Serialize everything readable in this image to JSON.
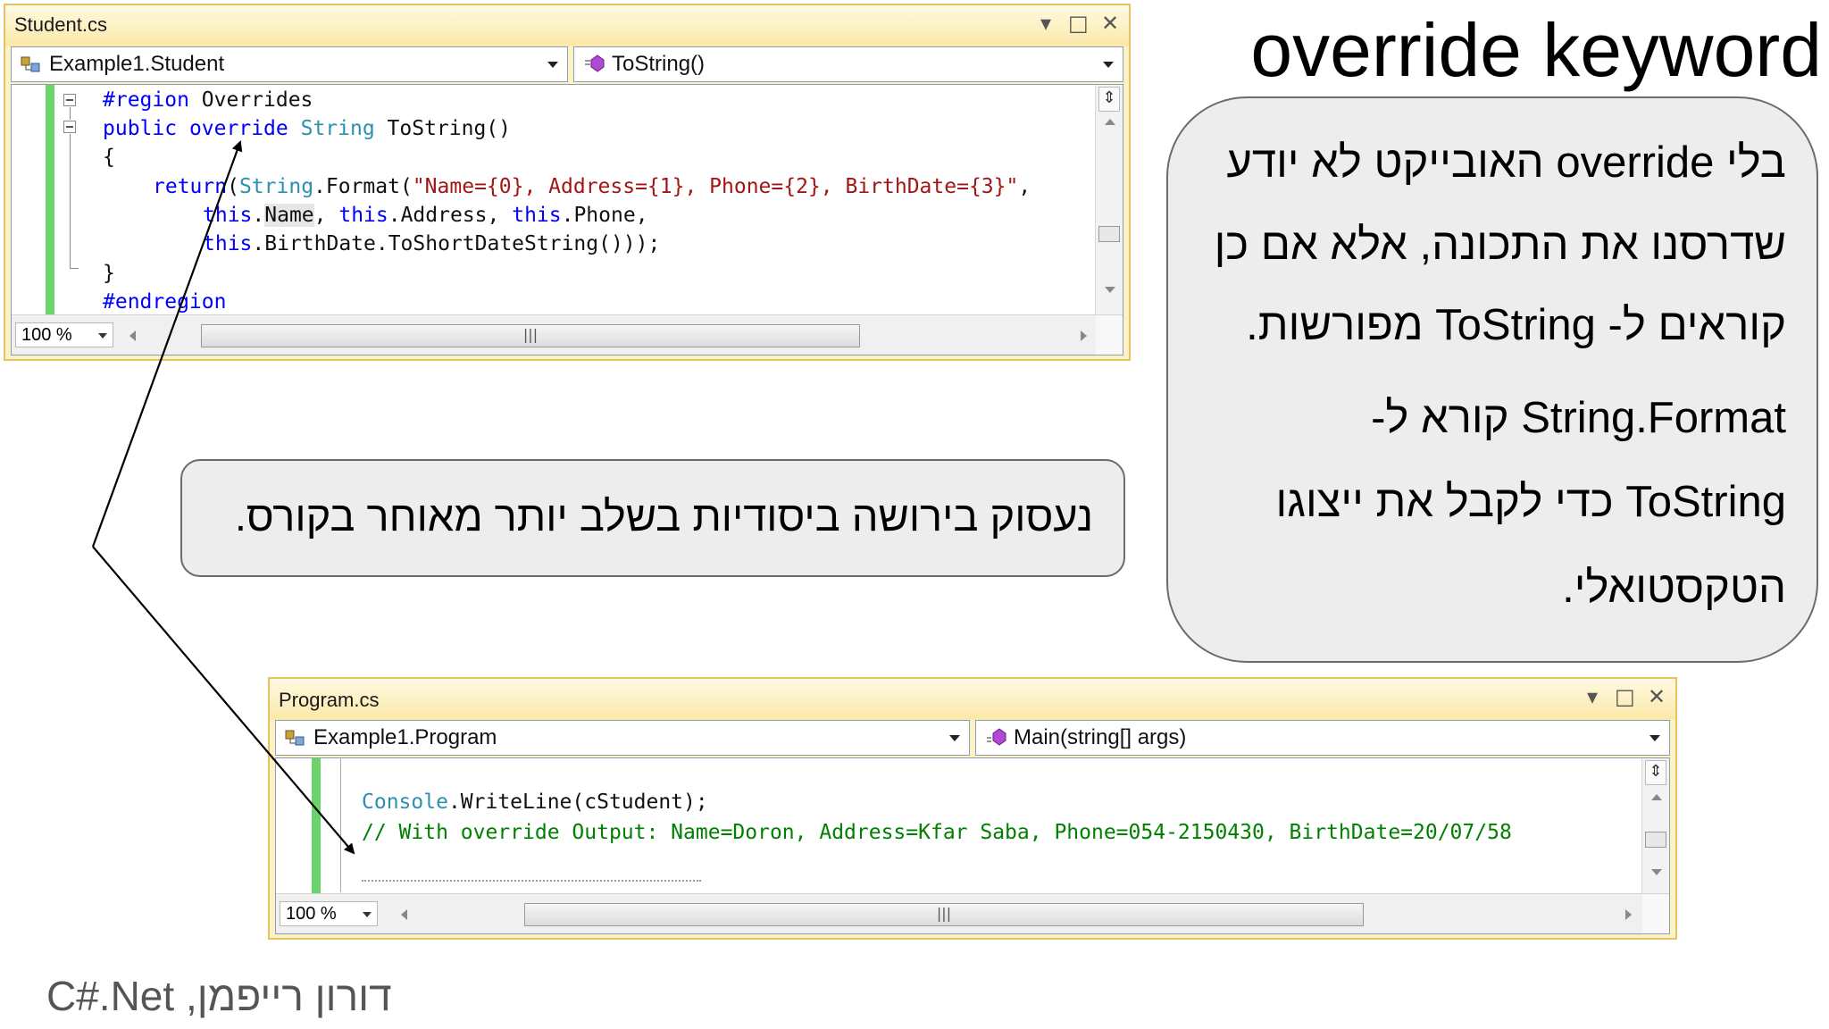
{
  "slide": {
    "title": "override keyword",
    "footer": "דורון רייפמן, C#.Net"
  },
  "callout_right": {
    "lines": [
      "בלי override האובייקט לא יודע",
      "שדרסנו את התכונה, אלא אם כן",
      "קוראים ל- ToString מפורשות.",
      "String.Format קורא ל-",
      "ToString כדי לקבל את ייצוגו",
      "הטקסטואלי."
    ]
  },
  "callout_middle": {
    "text": "נעסוק בירושה ביסודיות בשלב יותר מאוחר בקורס."
  },
  "student_window": {
    "title": "Student.cs",
    "class_combo": "Example1.Student",
    "member_combo": "ToString()",
    "zoom": "100 %",
    "code": {
      "l1_kw": "#region",
      "l1_rest": " Overrides",
      "l2_kw1": "public",
      "l2_kw2": "override",
      "l2_type": "String",
      "l2_rest": " ToString()",
      "l3": "{",
      "l4_kw": "return",
      "l4_p": "(",
      "l4_type": "String",
      "l4_call": ".Format(",
      "l4_str": "\"Name={0}, Address={1}, Phone={2}, BirthDate={3}\"",
      "l4_end": ",",
      "l5_this1": "this",
      "l5_dot1": ".",
      "l5_name": "Name",
      "l5_mid": ", ",
      "l5_this2": "this",
      "l5_addr": ".Address, ",
      "l5_this3": "this",
      "l5_phone": ".Phone,",
      "l6_this": "this",
      "l6_rest": ".BirthDate.ToShortDateString()));",
      "l7": "}",
      "l8_kw": "#endregion"
    }
  },
  "program_window": {
    "title": "Program.cs",
    "class_combo": "Example1.Program",
    "member_combo": "Main(string[] args)",
    "zoom": "100 %",
    "code": {
      "l1_type": "Console",
      "l1_rest": ".WriteLine(cStudent);",
      "l2_comment": "// With override Output: Name=Doron, Address=Kfar Saba, Phone=054-2150430, BirthDate=20/07/58"
    }
  },
  "colors": {
    "keyword": "#0000ff",
    "type": "#2b91af",
    "string": "#a31515",
    "comment": "#008000",
    "window_border": "#e5c365",
    "change_bar": "#6bd36b",
    "callout_fill": "#ededed"
  }
}
